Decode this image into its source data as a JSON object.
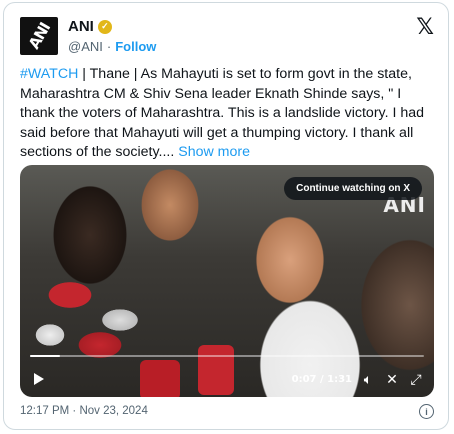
{
  "author": {
    "name": "ANI",
    "handle": "@ANI",
    "follow_label": "Follow",
    "avatar_text": "ANI",
    "separator": "·"
  },
  "tweet": {
    "hashtag": "#WATCH",
    "text": " | Thane | As Mahayuti is set to form govt in the state, Maharashtra CM & Shiv Sena leader Eknath Shinde says, \" I thank the voters of Maharashtra. This is a landslide victory. I had said before that Mahayuti will get a thumping victory. I thank all sections of the society....",
    "show_more": "Show more"
  },
  "video": {
    "continue_label": "Continue watching on X",
    "watermark": "ANI",
    "time_display": "0:07 / 1:31",
    "progress": 0.077
  },
  "footer": {
    "timestamp": "12:17 PM · Nov 23, 2024"
  },
  "colors": {
    "accent": "#1d9bf0",
    "verified": "#e2b719",
    "muted": "#536471"
  },
  "icons": {
    "verified": "verified-badge-icon",
    "x_logo": "x-logo-icon",
    "play": "play-icon",
    "volume": "volume-icon",
    "close": "close-icon",
    "fullscreen": "fullscreen-icon",
    "info": "info-icon"
  }
}
